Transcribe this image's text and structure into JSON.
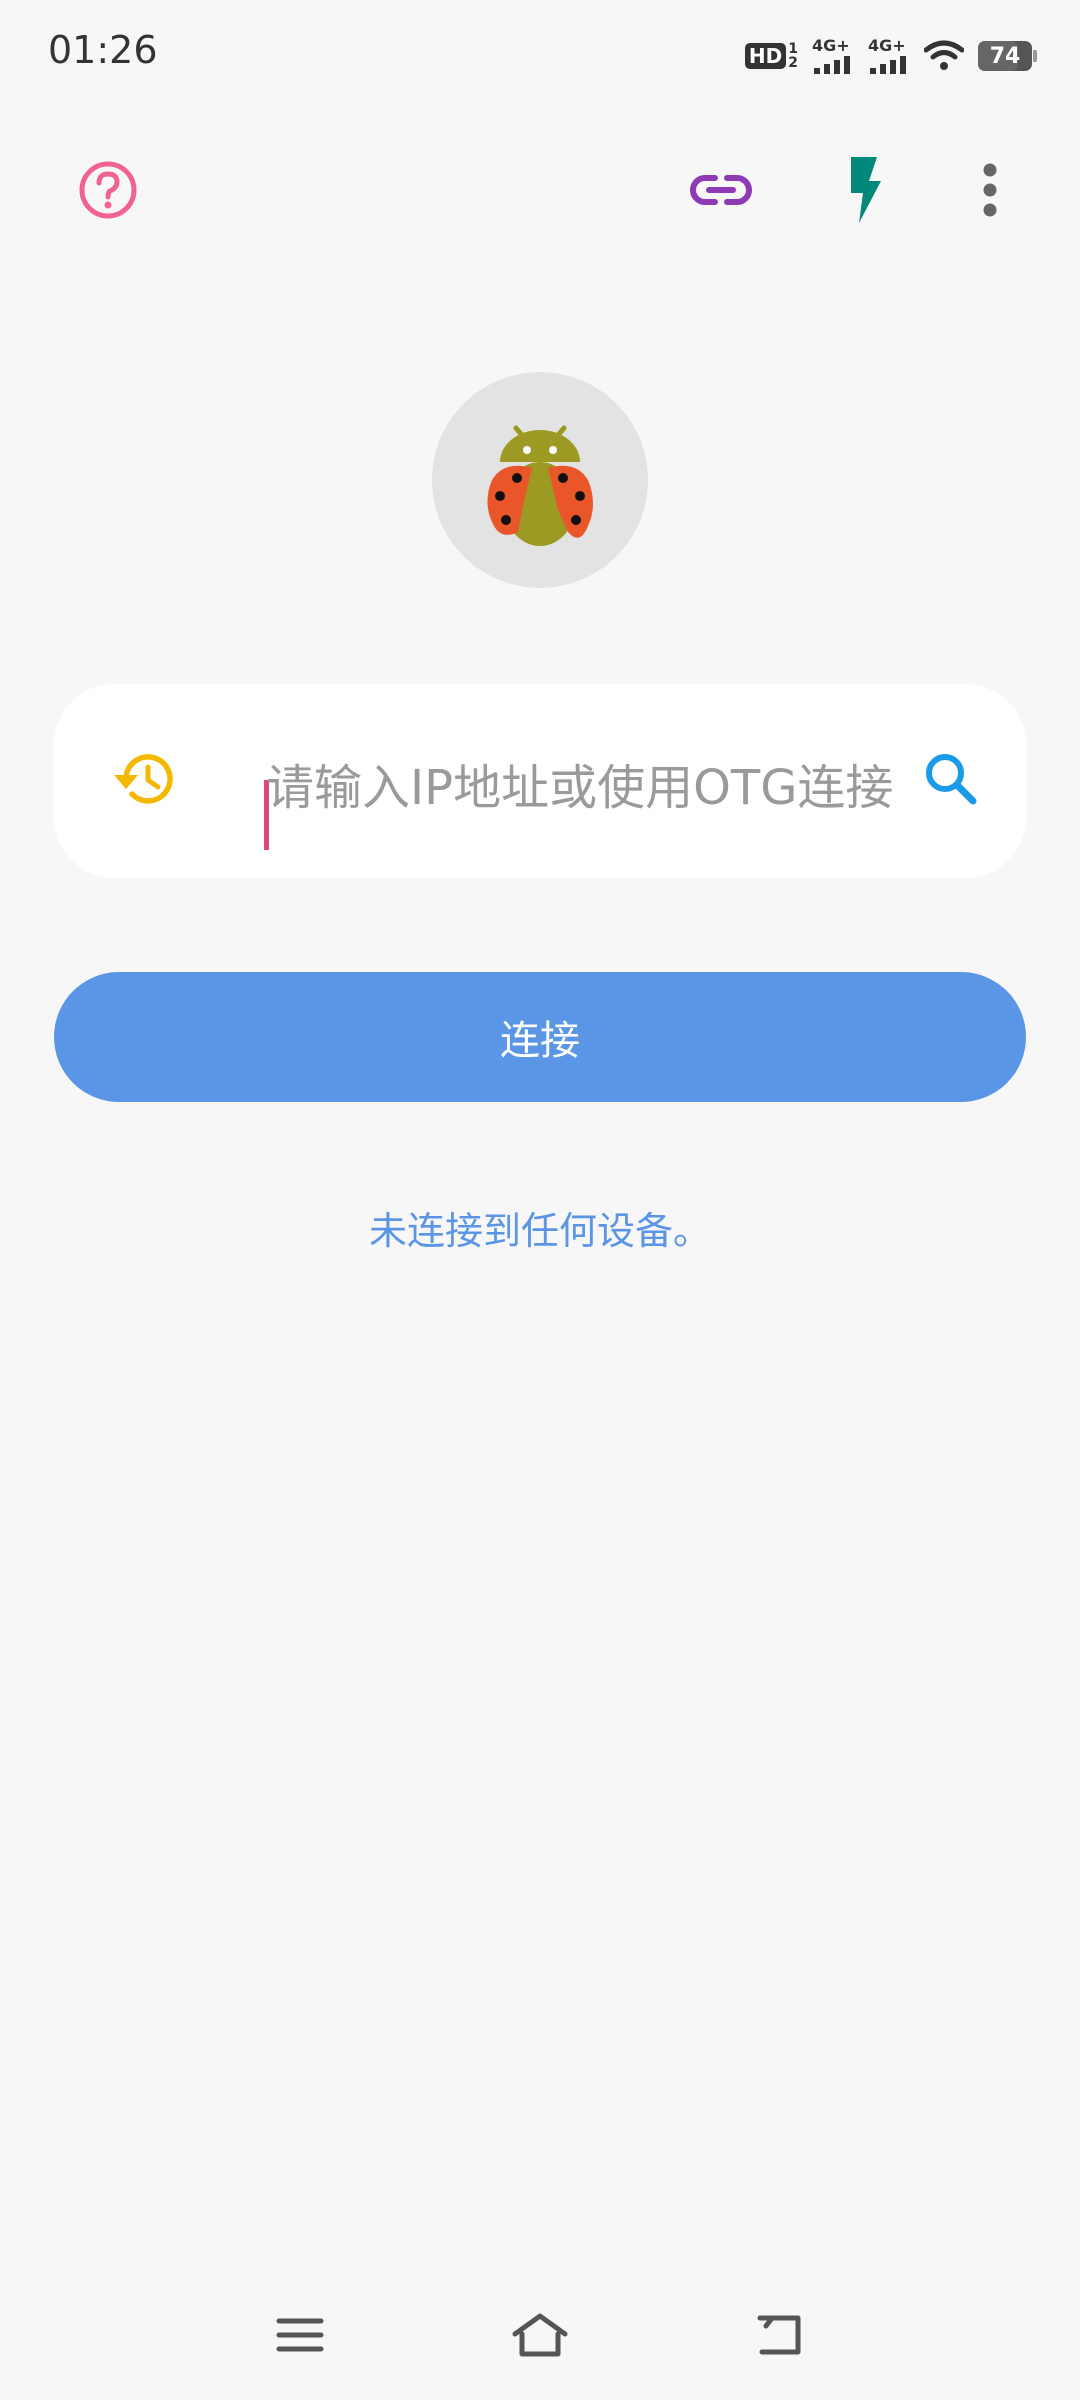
{
  "status_bar": {
    "time": "01:26",
    "hd_label": "HD",
    "hd_sub_top": "1",
    "hd_sub_bottom": "2",
    "net1_label": "4G+",
    "net2_label": "4G+",
    "battery": "74",
    "battery_level": 0.74
  },
  "toolbar": {
    "help_icon": "help-circle-icon",
    "link_icon": "link-icon",
    "flash_icon": "lightning-icon",
    "more_icon": "more-vert-icon"
  },
  "logo": {
    "icon": "android-ladybug-icon"
  },
  "ip_input": {
    "placeholder": "请输入IP地址或使用OTG连接",
    "value": "",
    "history_icon": "history-icon",
    "search_icon": "search-icon"
  },
  "connect_button": {
    "label": "连接"
  },
  "status_message": "未连接到任何设备。",
  "nav": {
    "menu_icon": "menu-icon",
    "home_icon": "home-icon",
    "back_icon": "back-icon"
  },
  "colors": {
    "help": "#f06292",
    "link": "#8e3ab5",
    "flash": "#00897b",
    "more": "#666666",
    "history": "#f5b800",
    "search": "#1a9be8",
    "primary": "#5b95e5",
    "background": "#f7f7f7"
  }
}
